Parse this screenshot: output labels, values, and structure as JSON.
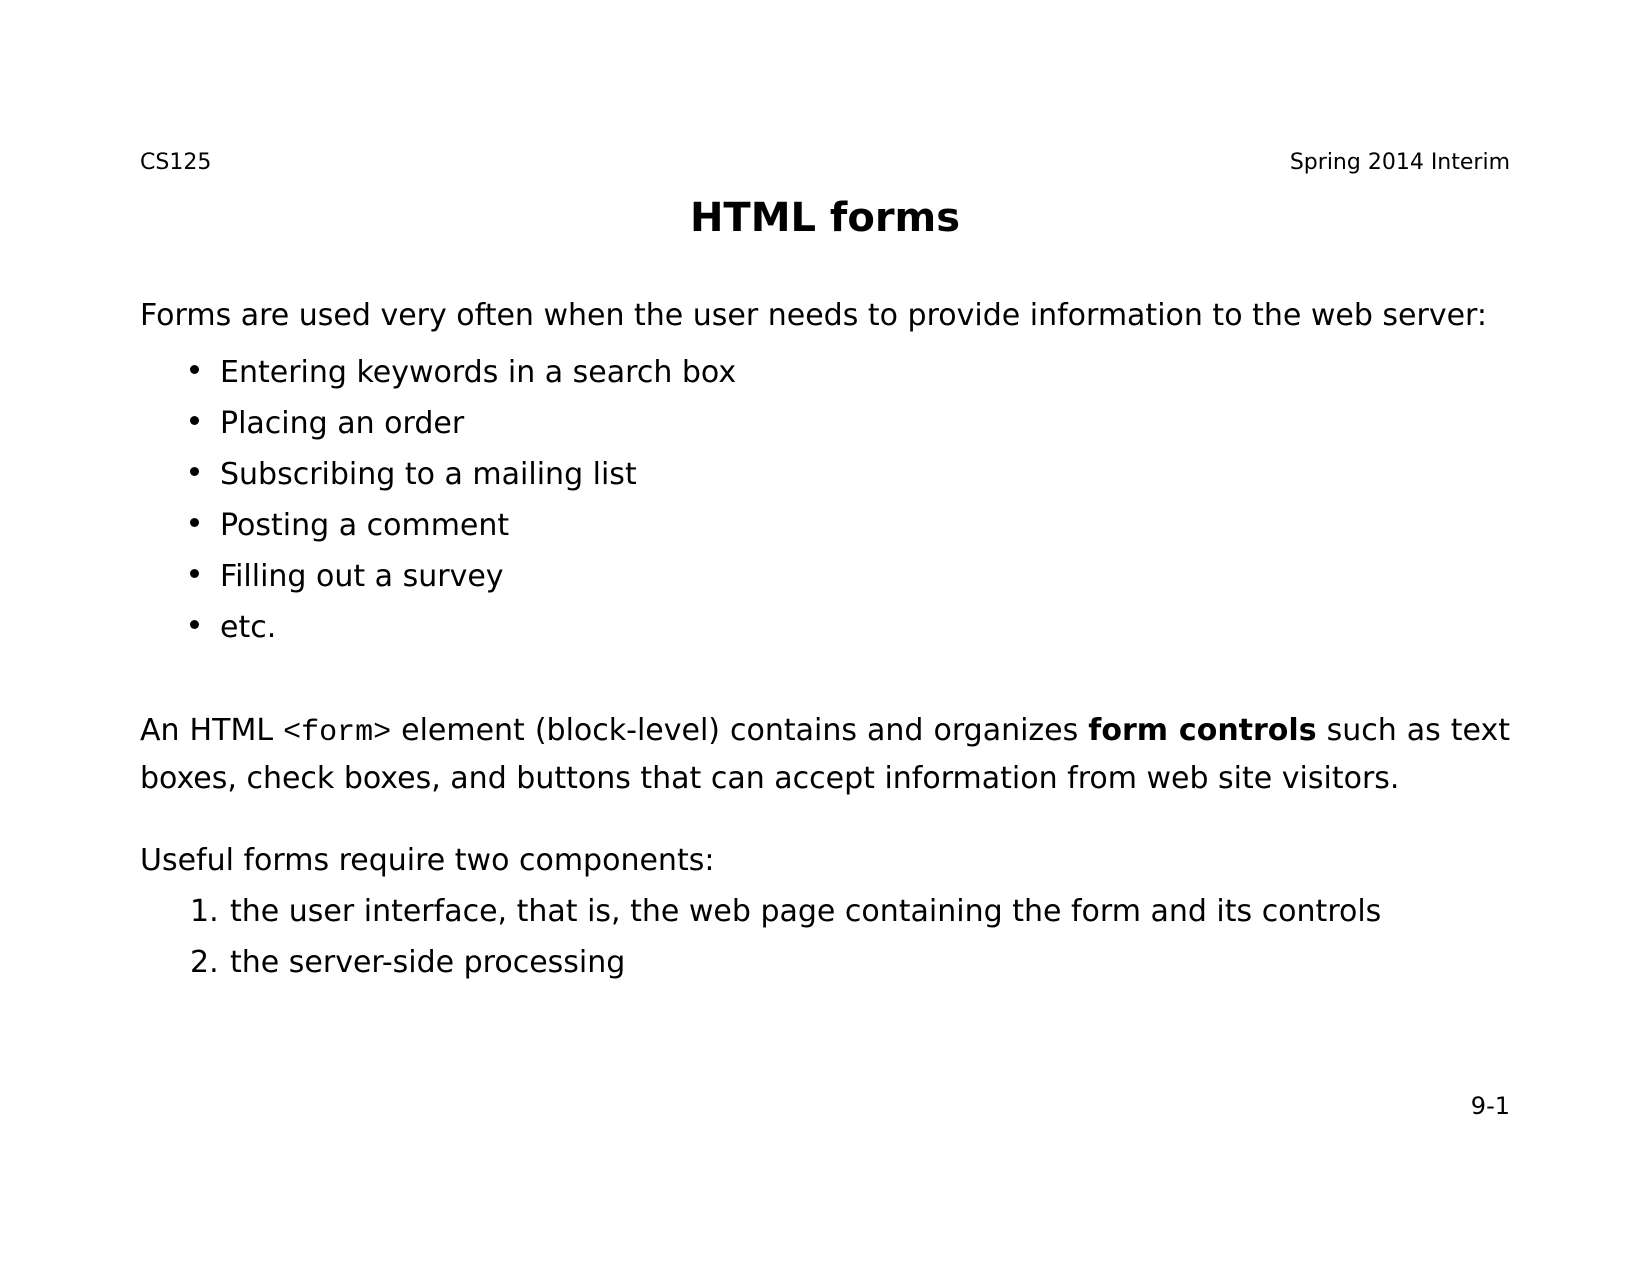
{
  "header": {
    "left": "CS125",
    "right": "Spring 2014 Interim"
  },
  "title": "HTML forms",
  "intro": "Forms are used very often when the user needs to provide information to the web server:",
  "bullets": [
    "Entering keywords in a search box",
    "Placing an order",
    "Subscribing to a mailing list",
    "Posting a comment",
    "Filling out a survey",
    "etc."
  ],
  "para": {
    "seg1": "An HTML ",
    "code": "<form>",
    "seg2": " element (block-level) contains and organizes ",
    "bold": "form controls",
    "seg3": " such as text boxes, check boxes, and buttons that can accept information from web site visitors."
  },
  "sub": "Useful forms require two components:",
  "numbers": [
    "the user interface, that is, the web page containing the form and its controls",
    "the server-side processing"
  ],
  "pagenum": "9-1"
}
